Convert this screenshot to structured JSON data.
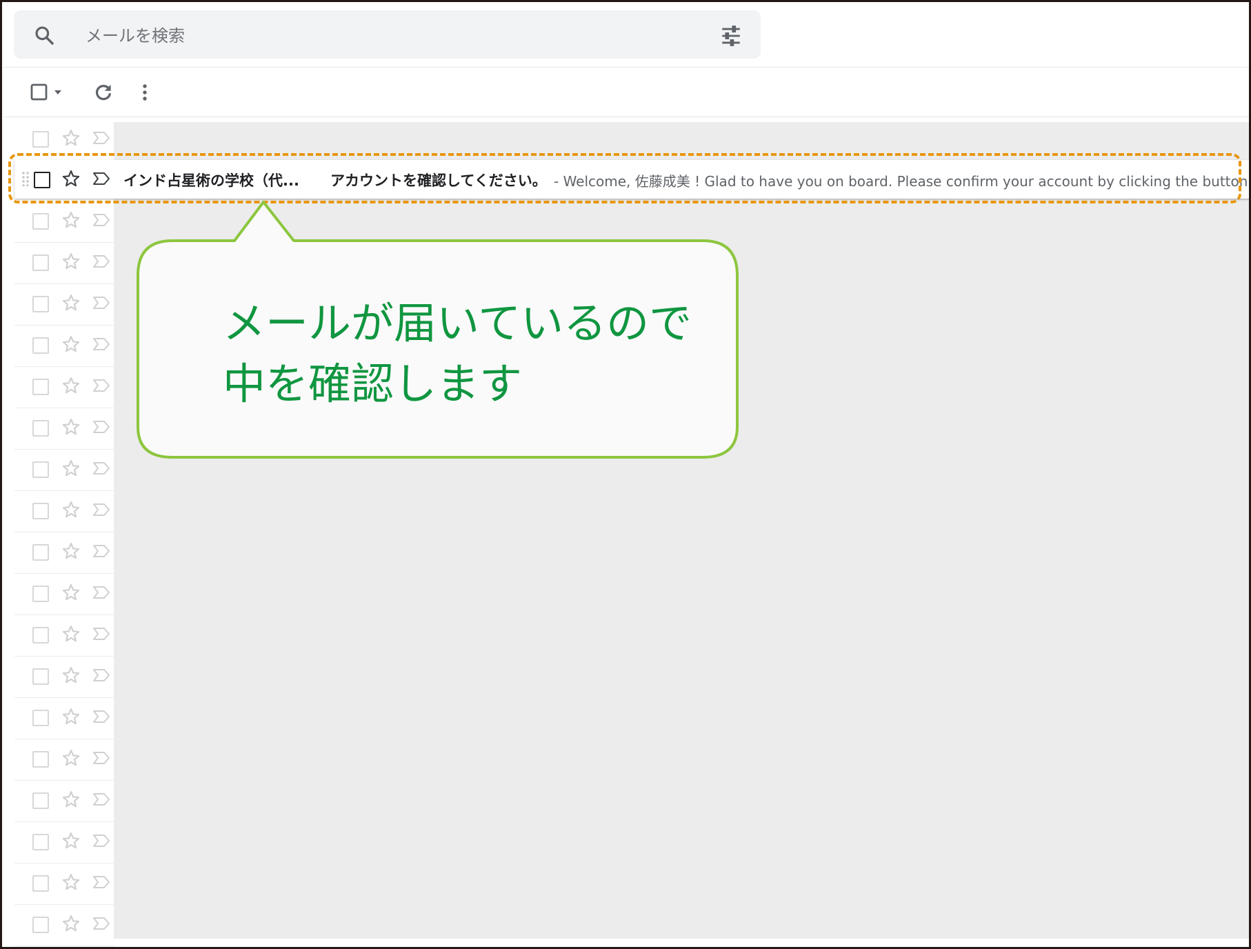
{
  "search": {
    "placeholder": "メールを検索",
    "icon": "search-icon",
    "filter_icon": "tune-icon"
  },
  "toolbar": {
    "select_icon": "checkbox-dropdown-icon",
    "refresh_icon": "refresh-icon",
    "more_icon": "more-vert-icon"
  },
  "email": {
    "sender": "インド占星術の学校（代...",
    "subject": "アカウントを確認してください。",
    "snippet": "- Welcome, 佐藤成美 ! Glad to have you on board. Please confirm your account by clicking the button below",
    "unread": true
  },
  "callout": {
    "line1": "メールが届いているので",
    "line2": "中を確認します"
  },
  "colors": {
    "highlight": "#e8960c",
    "callout_border": "#8dc63f",
    "callout_text": "#109640",
    "frame": "#231815"
  }
}
